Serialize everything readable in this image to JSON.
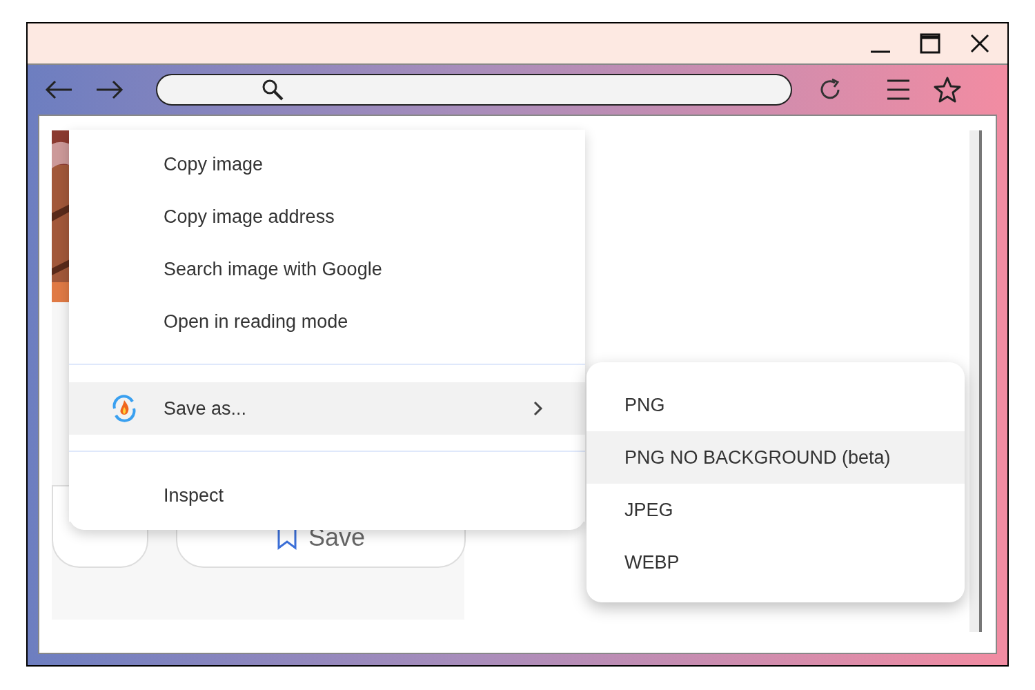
{
  "page": {
    "button": "Save"
  },
  "context_menu": {
    "items": [
      {
        "kind": "item",
        "label": "Copy image",
        "selected": false
      },
      {
        "kind": "item",
        "label": "Copy image address",
        "selected": false
      },
      {
        "kind": "item",
        "label": "Search image with Google",
        "selected": false
      },
      {
        "kind": "item",
        "label": "Open in reading mode",
        "selected": false
      },
      {
        "kind": "separator"
      },
      {
        "kind": "submenu",
        "label": "Save as...",
        "selected": true
      },
      {
        "kind": "separator"
      },
      {
        "kind": "item",
        "label": "Inspect",
        "selected": false
      }
    ]
  },
  "submenu": {
    "items": [
      {
        "label": "PNG",
        "selected": false
      },
      {
        "label": "PNG NO BACKGROUND (beta)",
        "selected": true
      },
      {
        "label": "JPEG",
        "selected": false
      },
      {
        "label": "WEBP",
        "selected": false
      }
    ]
  }
}
